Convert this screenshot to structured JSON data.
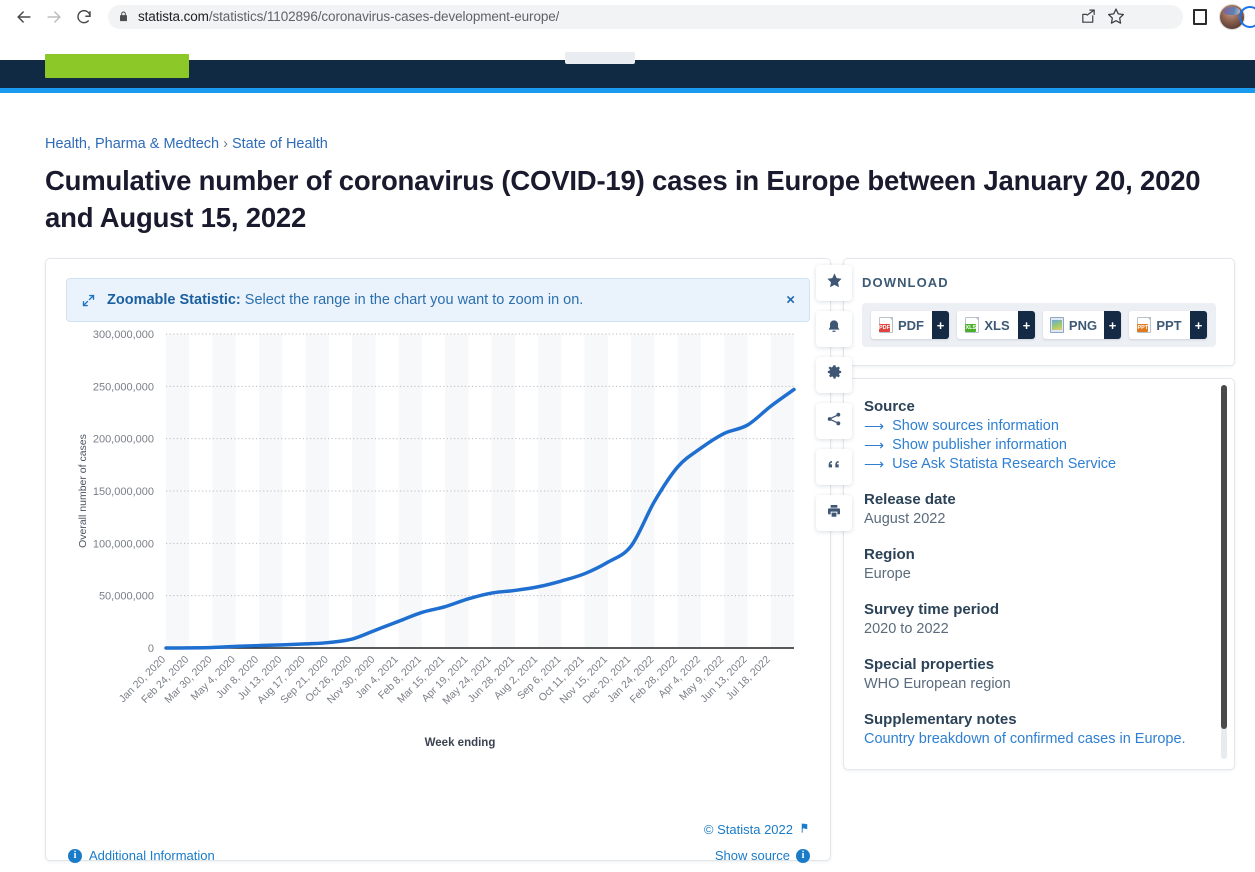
{
  "browser": {
    "back_label": "Back",
    "forward_label": "Forward",
    "reload_label": "Reload",
    "url_domain": "statista.com",
    "url_path": "/statistics/1102896/coronavirus-cases-development-europe/",
    "share_label": "Share this page",
    "bookmark_label": "Bookmark this tab",
    "extensions_label": "Extensions",
    "profile_label": "Profile"
  },
  "site": {
    "cta_label": "",
    "breadcrumb": {
      "level1": "Health, Pharma & Medtech",
      "separator": "›",
      "level2": "State of Health"
    },
    "page_title": "Cumulative number of coronavirus (COVID-19) cases in Europe between January 20, 2020 and August 15, 2022"
  },
  "banner": {
    "label": "Zoomable Statistic:",
    "text": " Select the range in the chart you want to zoom in on.",
    "close": "×"
  },
  "toolbar": {
    "items": [
      {
        "icon": "star-icon",
        "label": "Add to favorites"
      },
      {
        "icon": "bell-icon",
        "label": "Get notified"
      },
      {
        "icon": "gear-icon",
        "label": "Settings"
      },
      {
        "icon": "share-icon",
        "label": "Share"
      },
      {
        "icon": "quote-icon",
        "label": "Cite"
      },
      {
        "icon": "print-icon",
        "label": "Print"
      }
    ]
  },
  "chart_footer": {
    "additional_information": "Additional Information",
    "copyright": "© Statista 2022",
    "show_source": "Show source"
  },
  "download": {
    "title": "DOWNLOAD",
    "buttons": [
      {
        "label": "PDF",
        "plus": "+",
        "icon": "pdf-file-icon"
      },
      {
        "label": "XLS",
        "plus": "+",
        "icon": "xls-file-icon"
      },
      {
        "label": "PNG",
        "plus": "+",
        "icon": "png-file-icon"
      },
      {
        "label": "PPT",
        "plus": "+",
        "icon": "ppt-file-icon"
      }
    ]
  },
  "meta": {
    "source_heading": "Source",
    "source_links": [
      "Show sources information",
      "Show publisher information",
      "Use Ask Statista Research Service"
    ],
    "release_date_heading": "Release date",
    "release_date_value": "August 2022",
    "region_heading": "Region",
    "region_value": "Europe",
    "survey_heading": "Survey time period",
    "survey_value": "2020 to 2022",
    "special_heading": "Special properties",
    "special_value": "WHO European region",
    "supplementary_heading": "Supplementary notes",
    "supplementary_value": "Country breakdown of confirmed cases in Europe."
  },
  "colors": {
    "line": "#1f6fd0",
    "link": "#2e7fd1",
    "navy": "#102a43",
    "green": "#8bc828",
    "accent_blue": "#1a9bf0"
  },
  "chart_data": {
    "type": "line",
    "title": "Cumulative number of coronavirus (COVID-19) cases in Europe between January 20, 2020 and August 15, 2022",
    "xlabel": "Week ending",
    "ylabel": "Overall number of cases",
    "ylim": [
      0,
      300000000
    ],
    "ytick_labels": [
      "0",
      "50,000,000",
      "100,000,000",
      "150,000,000",
      "200,000,000",
      "250,000,000",
      "300,000,000"
    ],
    "ytick_values": [
      0,
      50000000,
      100000000,
      150000000,
      200000000,
      250000000,
      300000000
    ],
    "grid": true,
    "legend": "none",
    "categories": [
      "Jan 20, 2020",
      "Feb 24, 2020",
      "Mar 30, 2020",
      "May 4, 2020",
      "Jun 8, 2020",
      "Jul 13, 2020",
      "Aug 17, 2020",
      "Sep 21, 2020",
      "Oct 26, 2020",
      "Nov 30, 2020",
      "Jan 4, 2021",
      "Feb 8, 2021",
      "Mar 15, 2021",
      "Apr 19, 2021",
      "May 24, 2021",
      "Jun 28, 2021",
      "Aug 2, 2021",
      "Sep 6, 2021",
      "Oct 11, 2021",
      "Nov 15, 2021",
      "Dec 20, 2021",
      "Jan 24, 2022",
      "Feb 28, 2022",
      "Apr 4, 2022",
      "May 9, 2022",
      "Jun 13, 2022",
      "Jul 18, 2022"
    ],
    "values": [
      0,
      100000,
      500000,
      1600000,
      2300000,
      3000000,
      3900000,
      5200000,
      8500000,
      17000000,
      25500000,
      34000000,
      39500000,
      47000000,
      52500000,
      55000000,
      58500000,
      64000000,
      71000000,
      82000000,
      97500000,
      140000000,
      173000000,
      191000000,
      205000000,
      213000000,
      231000000
    ],
    "final_point": {
      "label": "Aug 15, 2022",
      "value": 247000000
    },
    "line_color": "#1f6fd0",
    "line_width": 3.5
  }
}
